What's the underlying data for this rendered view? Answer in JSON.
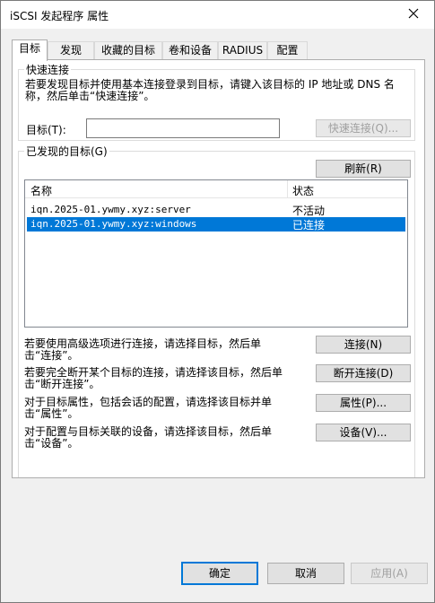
{
  "window": {
    "title": "iSCSI 发起程序 属性"
  },
  "tabs": [
    {
      "label": "目标"
    },
    {
      "label": "发现"
    },
    {
      "label": "收藏的目标"
    },
    {
      "label": "卷和设备"
    },
    {
      "label": "RADIUS"
    },
    {
      "label": "配置"
    }
  ],
  "quick_connect": {
    "group_title": "快速连接",
    "description": "若要发现目标并使用基本连接登录到目标，请键入该目标的 IP 地址或 DNS 名称，然后单击“快速连接”。",
    "target_label": "目标(T):",
    "target_value": "",
    "button_label": "快速连接(Q)..."
  },
  "discovered": {
    "group_title": "已发现的目标(G)",
    "refresh_label": "刷新(R)",
    "columns": {
      "name": "名称",
      "status": "状态"
    },
    "rows": [
      {
        "name": "iqn.2025-01.ywmy.xyz:server",
        "status": "不活动"
      },
      {
        "name": "iqn.2025-01.ywmy.xyz:windows",
        "status": "已连接"
      }
    ],
    "actions": [
      {
        "text": "若要使用高级选项进行连接，请选择目标，然后单击“连接”。",
        "button": "连接(N)"
      },
      {
        "text": "若要完全断开某个目标的连接，请选择该目标，然后单击“断开连接”。",
        "button": "断开连接(D)"
      },
      {
        "text": "对于目标属性，包括会话的配置，请选择该目标并单击“属性”。",
        "button": "属性(P)..."
      },
      {
        "text": "对于配置与目标关联的设备，请选择该目标，然后单击“设备”。",
        "button": "设备(V)..."
      }
    ]
  },
  "footer": {
    "ok_label": "确定",
    "cancel_label": "取消",
    "apply_label": "应用(A)"
  },
  "colors": {
    "selection": "#0078d7",
    "window_bg": "#f0f0f0"
  },
  "icons": {
    "close": "close-icon"
  }
}
